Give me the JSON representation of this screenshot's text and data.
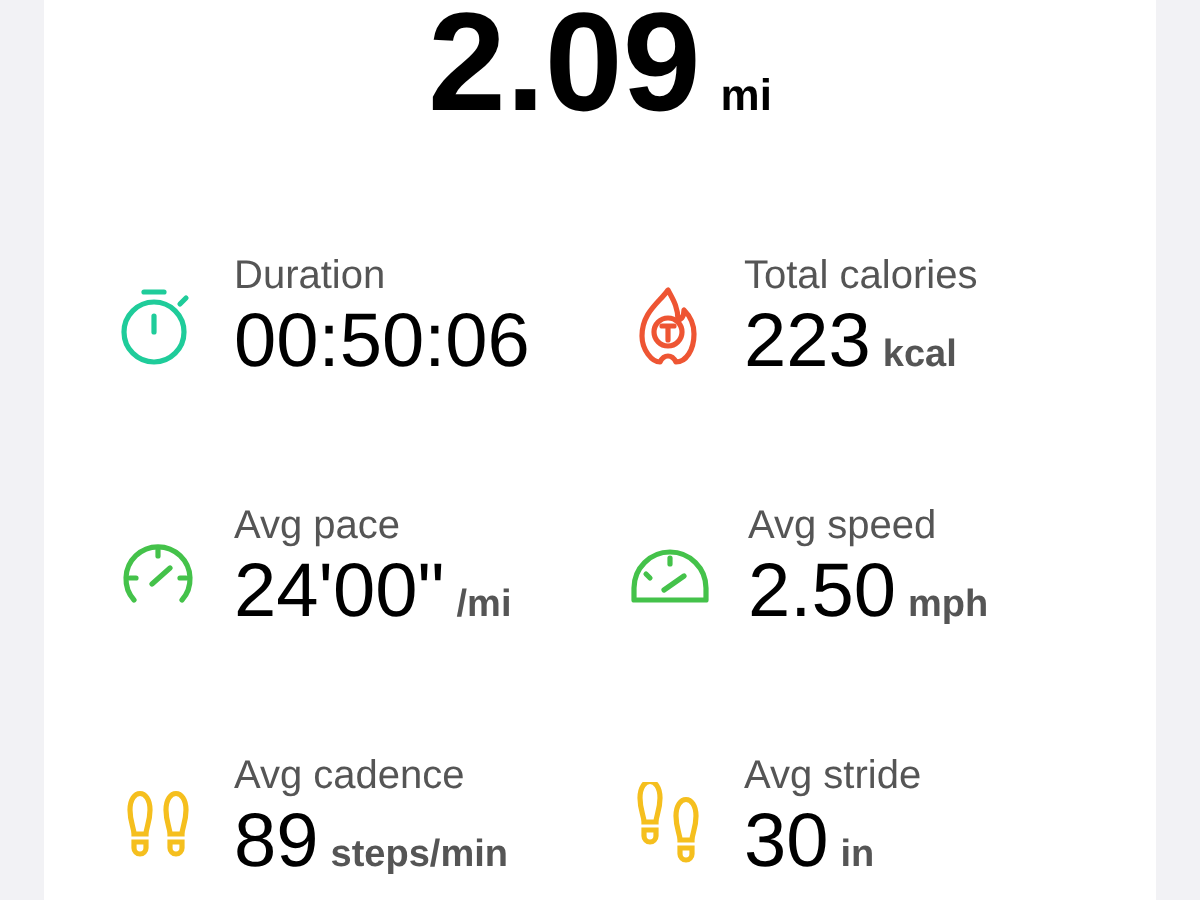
{
  "distance": {
    "value": "2.09",
    "unit": "mi"
  },
  "stats": [
    {
      "kind": "duration",
      "label": "Duration",
      "value": "00:50:06"
    },
    {
      "kind": "calories",
      "label": "Total calories",
      "value": "223",
      "unit": "kcal"
    },
    {
      "kind": "pace",
      "label": "Avg pace",
      "value": "24'00\"",
      "unit": "/mi"
    },
    {
      "kind": "speed",
      "label": "Avg speed",
      "value": "2.50",
      "unit": "mph"
    },
    {
      "kind": "cadence",
      "label": "Avg cadence",
      "value": "89",
      "unit": "steps/min"
    },
    {
      "kind": "stride",
      "label": "Avg stride",
      "value": "30",
      "unit": "in"
    }
  ]
}
